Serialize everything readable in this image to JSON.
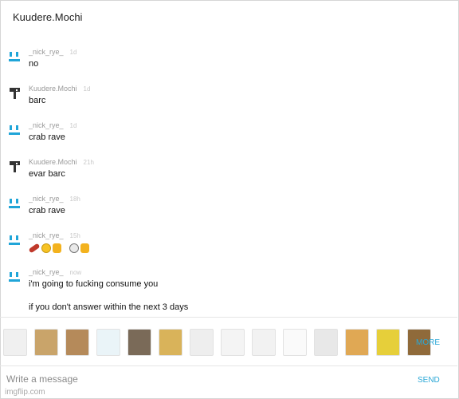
{
  "title": "Kuudere.Mochi",
  "messages": [
    {
      "user": "_nick_rye_",
      "time": "1d",
      "text": "no",
      "avatar": "bars"
    },
    {
      "user": "Kuudere.Mochi",
      "time": "1d",
      "text": "barc",
      "avatar": "hammer"
    },
    {
      "user": "_nick_rye_",
      "time": "1d",
      "text": "crab rave",
      "avatar": "bars"
    },
    {
      "user": "Kuudere.Mochi",
      "time": "21h",
      "text": "evar barc",
      "avatar": "hammer"
    },
    {
      "user": "_nick_rye_",
      "time": "18h",
      "text": "crab rave",
      "avatar": "bars"
    },
    {
      "user": "_nick_rye_",
      "time": "15h",
      "text": "",
      "avatar": "bars",
      "emojis": [
        "dynamite-emoji",
        "grin-emoji",
        "thumbs-up-emoji",
        "skull-emoji",
        "thumbs-up-emoji"
      ]
    },
    {
      "user": "_nick_rye_",
      "time": "now",
      "text": "i'm going to fucking consume you",
      "text2": "if you don't answer within the next 3 days",
      "avatar": "bars"
    }
  ],
  "stickers": [
    "rage-face",
    "cat-face",
    "jesus-face",
    "crying-face",
    "hat-meme",
    "pixel-face",
    "derp-face",
    "troll-face",
    "sad-face",
    "thinking-face",
    "laughing-face",
    "doge-face",
    "spongebob-face",
    "leo-face"
  ],
  "sticker_colors": [
    "#f0f0f0",
    "#c9a46a",
    "#b58a5a",
    "#eaf4f8",
    "#7a6a58",
    "#d9b35a",
    "#eeeeee",
    "#f4f4f4",
    "#f2f2f2",
    "#fafafa",
    "#e8e8e8",
    "#e0a854",
    "#e6cf3a",
    "#8f6a3a"
  ],
  "more_label": "MORE",
  "compose": {
    "placeholder": "Write a message"
  },
  "send_label": "SEND",
  "watermark": "imgflip.com",
  "colors": {
    "accent": "#2aa7d6",
    "avatar_blue": "#20a5d8",
    "avatar_dark": "#333333"
  }
}
